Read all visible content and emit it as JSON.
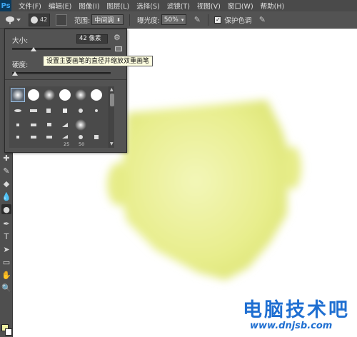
{
  "app": {
    "logo": "Ps"
  },
  "menu": [
    "文件(F)",
    "编辑(E)",
    "图像(I)",
    "图层(L)",
    "选择(S)",
    "滤镜(T)",
    "视图(V)",
    "窗口(W)",
    "帮助(H)"
  ],
  "options": {
    "brush_size_value": "42",
    "range_label": "范围:",
    "range_value": "中间调",
    "exposure_label": "曝光度:",
    "exposure_value": "50%",
    "protect_tones_label": "保护色调",
    "protect_tones_checked": true
  },
  "brush_panel": {
    "size_label": "大小:",
    "size_value": "42 像素",
    "hardness_label": "硬度:",
    "size_slider_fraction": 0.22,
    "hardness_slider_fraction": 0.0,
    "preset_numbers": [
      "25",
      "50"
    ]
  },
  "tooltip": {
    "text": "设置主要画笔的直径并缩放双重画笔"
  },
  "colors": {
    "foreground": "#eef0a3",
    "background": "#ffffff",
    "face_fill": "#e6ec88"
  },
  "watermark": {
    "text": "电脑技术吧",
    "url": "www.dnjsb.com"
  },
  "icons": [
    "dodge-icon",
    "brush-panel-toggle-icon",
    "gear-icon",
    "airbrush-icon",
    "pressure-icon"
  ]
}
